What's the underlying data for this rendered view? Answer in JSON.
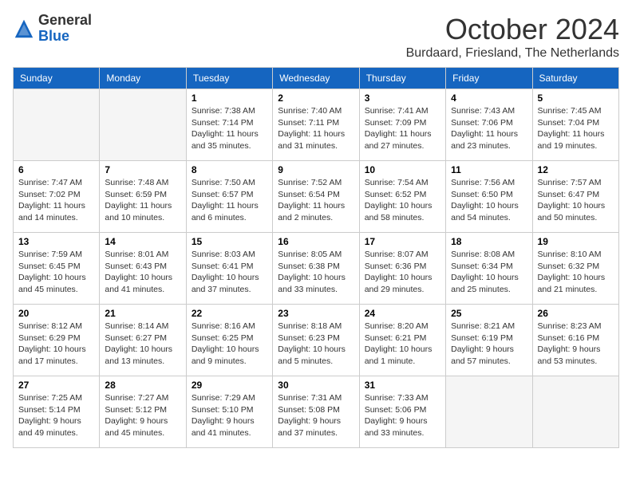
{
  "header": {
    "logo_general": "General",
    "logo_blue": "Blue",
    "month_title": "October 2024",
    "subtitle": "Burdaard, Friesland, The Netherlands"
  },
  "weekdays": [
    "Sunday",
    "Monday",
    "Tuesday",
    "Wednesday",
    "Thursday",
    "Friday",
    "Saturday"
  ],
  "weeks": [
    [
      {
        "day": "",
        "sunrise": "",
        "sunset": "",
        "daylight": ""
      },
      {
        "day": "",
        "sunrise": "",
        "sunset": "",
        "daylight": ""
      },
      {
        "day": "1",
        "sunrise": "Sunrise: 7:38 AM",
        "sunset": "Sunset: 7:14 PM",
        "daylight": "Daylight: 11 hours and 35 minutes."
      },
      {
        "day": "2",
        "sunrise": "Sunrise: 7:40 AM",
        "sunset": "Sunset: 7:11 PM",
        "daylight": "Daylight: 11 hours and 31 minutes."
      },
      {
        "day": "3",
        "sunrise": "Sunrise: 7:41 AM",
        "sunset": "Sunset: 7:09 PM",
        "daylight": "Daylight: 11 hours and 27 minutes."
      },
      {
        "day": "4",
        "sunrise": "Sunrise: 7:43 AM",
        "sunset": "Sunset: 7:06 PM",
        "daylight": "Daylight: 11 hours and 23 minutes."
      },
      {
        "day": "5",
        "sunrise": "Sunrise: 7:45 AM",
        "sunset": "Sunset: 7:04 PM",
        "daylight": "Daylight: 11 hours and 19 minutes."
      }
    ],
    [
      {
        "day": "6",
        "sunrise": "Sunrise: 7:47 AM",
        "sunset": "Sunset: 7:02 PM",
        "daylight": "Daylight: 11 hours and 14 minutes."
      },
      {
        "day": "7",
        "sunrise": "Sunrise: 7:48 AM",
        "sunset": "Sunset: 6:59 PM",
        "daylight": "Daylight: 11 hours and 10 minutes."
      },
      {
        "day": "8",
        "sunrise": "Sunrise: 7:50 AM",
        "sunset": "Sunset: 6:57 PM",
        "daylight": "Daylight: 11 hours and 6 minutes."
      },
      {
        "day": "9",
        "sunrise": "Sunrise: 7:52 AM",
        "sunset": "Sunset: 6:54 PM",
        "daylight": "Daylight: 11 hours and 2 minutes."
      },
      {
        "day": "10",
        "sunrise": "Sunrise: 7:54 AM",
        "sunset": "Sunset: 6:52 PM",
        "daylight": "Daylight: 10 hours and 58 minutes."
      },
      {
        "day": "11",
        "sunrise": "Sunrise: 7:56 AM",
        "sunset": "Sunset: 6:50 PM",
        "daylight": "Daylight: 10 hours and 54 minutes."
      },
      {
        "day": "12",
        "sunrise": "Sunrise: 7:57 AM",
        "sunset": "Sunset: 6:47 PM",
        "daylight": "Daylight: 10 hours and 50 minutes."
      }
    ],
    [
      {
        "day": "13",
        "sunrise": "Sunrise: 7:59 AM",
        "sunset": "Sunset: 6:45 PM",
        "daylight": "Daylight: 10 hours and 45 minutes."
      },
      {
        "day": "14",
        "sunrise": "Sunrise: 8:01 AM",
        "sunset": "Sunset: 6:43 PM",
        "daylight": "Daylight: 10 hours and 41 minutes."
      },
      {
        "day": "15",
        "sunrise": "Sunrise: 8:03 AM",
        "sunset": "Sunset: 6:41 PM",
        "daylight": "Daylight: 10 hours and 37 minutes."
      },
      {
        "day": "16",
        "sunrise": "Sunrise: 8:05 AM",
        "sunset": "Sunset: 6:38 PM",
        "daylight": "Daylight: 10 hours and 33 minutes."
      },
      {
        "day": "17",
        "sunrise": "Sunrise: 8:07 AM",
        "sunset": "Sunset: 6:36 PM",
        "daylight": "Daylight: 10 hours and 29 minutes."
      },
      {
        "day": "18",
        "sunrise": "Sunrise: 8:08 AM",
        "sunset": "Sunset: 6:34 PM",
        "daylight": "Daylight: 10 hours and 25 minutes."
      },
      {
        "day": "19",
        "sunrise": "Sunrise: 8:10 AM",
        "sunset": "Sunset: 6:32 PM",
        "daylight": "Daylight: 10 hours and 21 minutes."
      }
    ],
    [
      {
        "day": "20",
        "sunrise": "Sunrise: 8:12 AM",
        "sunset": "Sunset: 6:29 PM",
        "daylight": "Daylight: 10 hours and 17 minutes."
      },
      {
        "day": "21",
        "sunrise": "Sunrise: 8:14 AM",
        "sunset": "Sunset: 6:27 PM",
        "daylight": "Daylight: 10 hours and 13 minutes."
      },
      {
        "day": "22",
        "sunrise": "Sunrise: 8:16 AM",
        "sunset": "Sunset: 6:25 PM",
        "daylight": "Daylight: 10 hours and 9 minutes."
      },
      {
        "day": "23",
        "sunrise": "Sunrise: 8:18 AM",
        "sunset": "Sunset: 6:23 PM",
        "daylight": "Daylight: 10 hours and 5 minutes."
      },
      {
        "day": "24",
        "sunrise": "Sunrise: 8:20 AM",
        "sunset": "Sunset: 6:21 PM",
        "daylight": "Daylight: 10 hours and 1 minute."
      },
      {
        "day": "25",
        "sunrise": "Sunrise: 8:21 AM",
        "sunset": "Sunset: 6:19 PM",
        "daylight": "Daylight: 9 hours and 57 minutes."
      },
      {
        "day": "26",
        "sunrise": "Sunrise: 8:23 AM",
        "sunset": "Sunset: 6:16 PM",
        "daylight": "Daylight: 9 hours and 53 minutes."
      }
    ],
    [
      {
        "day": "27",
        "sunrise": "Sunrise: 7:25 AM",
        "sunset": "Sunset: 5:14 PM",
        "daylight": "Daylight: 9 hours and 49 minutes."
      },
      {
        "day": "28",
        "sunrise": "Sunrise: 7:27 AM",
        "sunset": "Sunset: 5:12 PM",
        "daylight": "Daylight: 9 hours and 45 minutes."
      },
      {
        "day": "29",
        "sunrise": "Sunrise: 7:29 AM",
        "sunset": "Sunset: 5:10 PM",
        "daylight": "Daylight: 9 hours and 41 minutes."
      },
      {
        "day": "30",
        "sunrise": "Sunrise: 7:31 AM",
        "sunset": "Sunset: 5:08 PM",
        "daylight": "Daylight: 9 hours and 37 minutes."
      },
      {
        "day": "31",
        "sunrise": "Sunrise: 7:33 AM",
        "sunset": "Sunset: 5:06 PM",
        "daylight": "Daylight: 9 hours and 33 minutes."
      },
      {
        "day": "",
        "sunrise": "",
        "sunset": "",
        "daylight": ""
      },
      {
        "day": "",
        "sunrise": "",
        "sunset": "",
        "daylight": ""
      }
    ]
  ]
}
